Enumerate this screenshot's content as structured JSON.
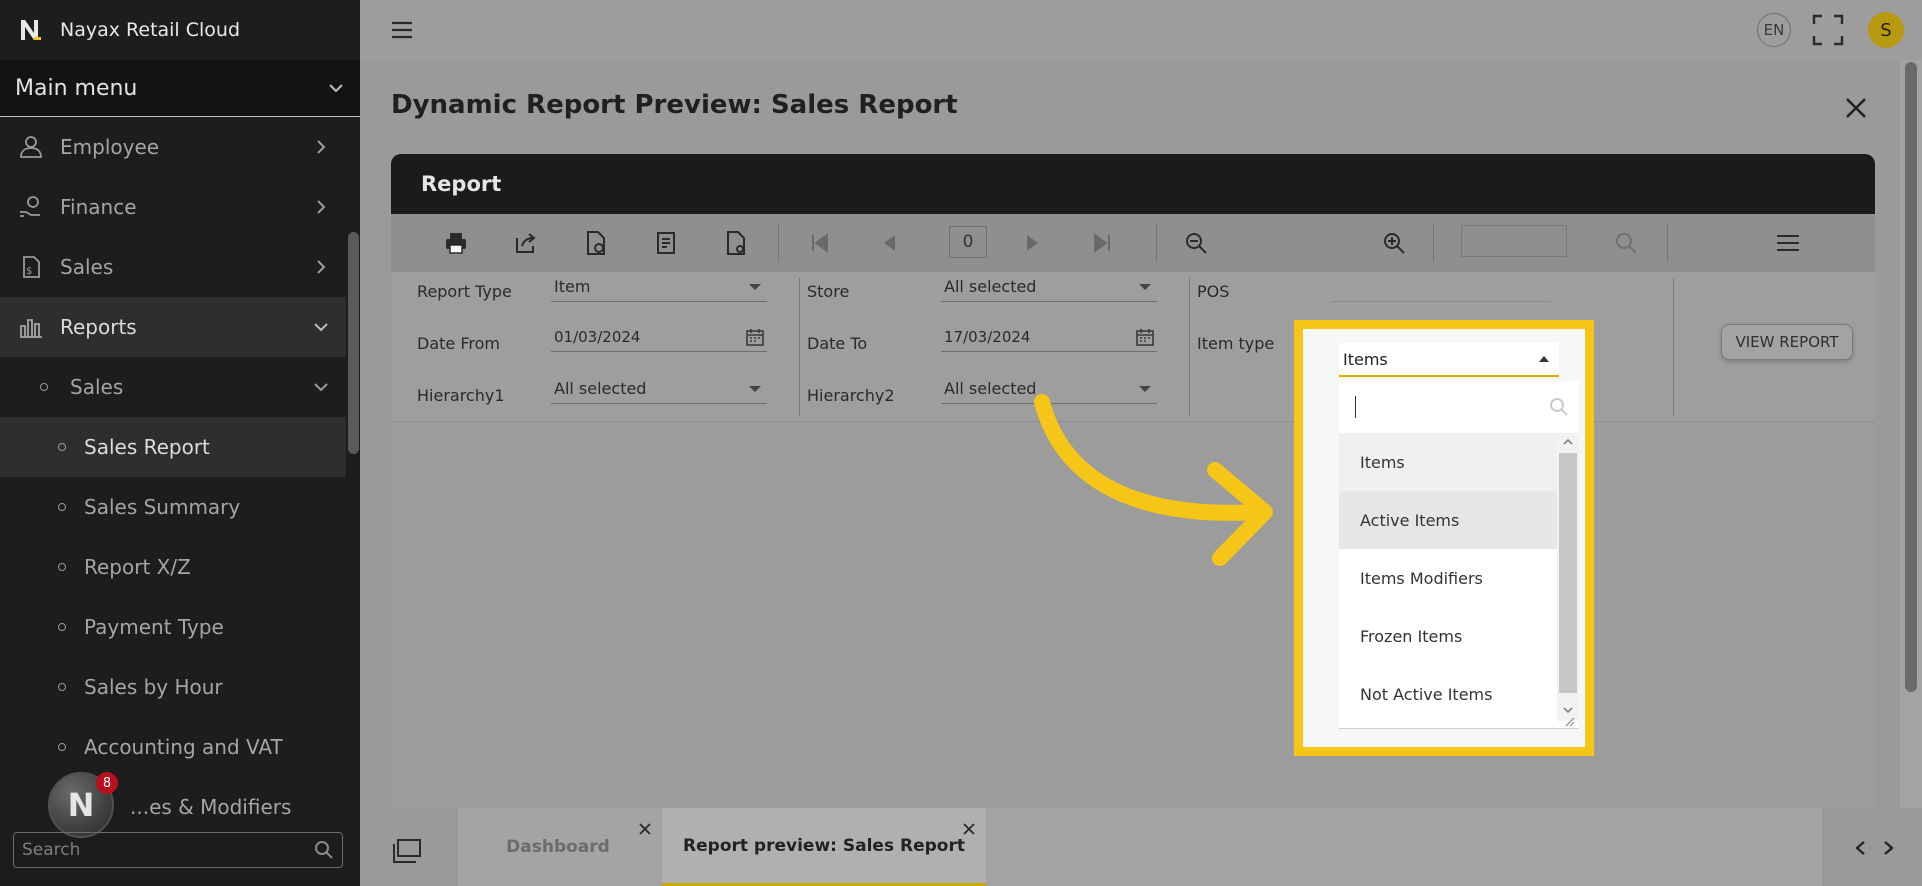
{
  "app": {
    "title": "Nayax Retail Cloud"
  },
  "sidebar": {
    "menu_title": "Main menu",
    "items": [
      {
        "label": "Employee",
        "icon": "employee-icon"
      },
      {
        "label": "Finance",
        "icon": "finance-icon"
      },
      {
        "label": "Sales",
        "icon": "sales-icon"
      },
      {
        "label": "Reports",
        "icon": "reports-icon"
      }
    ],
    "sub_group": {
      "label": "Sales"
    },
    "sub_items": [
      {
        "label": "Sales Report"
      },
      {
        "label": "Sales Summary"
      },
      {
        "label": "Report X/Z"
      },
      {
        "label": "Payment Type"
      },
      {
        "label": "Sales by Hour"
      },
      {
        "label": "Accounting and VAT"
      },
      {
        "label": "...es & Modifiers"
      }
    ],
    "notification_count": "8",
    "search_placeholder": "Search"
  },
  "topbar": {
    "language": "EN",
    "avatar_initial": "S"
  },
  "page": {
    "title": "Dynamic Report Preview: Sales Report"
  },
  "report": {
    "header": "Report",
    "toolbar": {
      "page_number": "0",
      "zoom_value": "100%"
    },
    "params": {
      "report_type": {
        "label": "Report Type",
        "value": "Item"
      },
      "store": {
        "label": "Store",
        "value": "All selected"
      },
      "pos": {
        "label": "POS",
        "value": ""
      },
      "date_from": {
        "label": "Date From",
        "value": "01/03/2024"
      },
      "date_to": {
        "label": "Date To",
        "value": "17/03/2024"
      },
      "item_type": {
        "label": "Item type",
        "value": "Items"
      },
      "hierarchy1": {
        "label": "Hierarchy1",
        "value": "All selected"
      },
      "hierarchy2": {
        "label": "Hierarchy2",
        "value": "All selected"
      }
    },
    "view_report_label": "VIEW REPORT"
  },
  "dropdown": {
    "search_value": "",
    "options": [
      "Items",
      "Active Items",
      "Items Modifiers",
      "Frozen Items",
      "Not Active Items"
    ],
    "selected_index": 0,
    "hover_index": 1
  },
  "tabs": [
    {
      "label": "Dashboard",
      "active": false
    },
    {
      "label": "Report preview: Sales Report",
      "active": true
    }
  ],
  "colors": {
    "highlight": "#f5c518",
    "sidebar_bg": "#1d1d1d",
    "active_tab_underline": "#c9a800"
  }
}
